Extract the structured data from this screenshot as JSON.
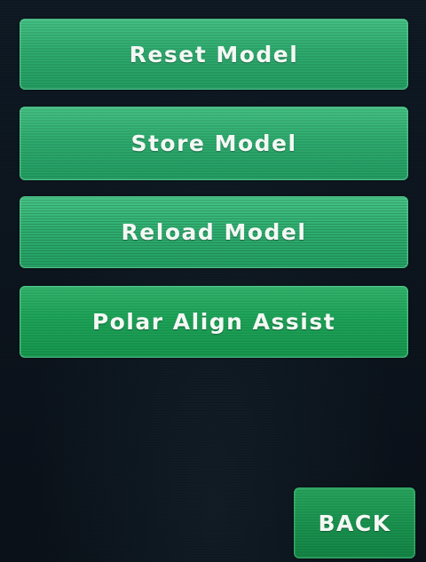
{
  "menu": {
    "buttons": [
      {
        "label": "Reset Model"
      },
      {
        "label": "Store Model"
      },
      {
        "label": "Reload Model"
      },
      {
        "label": "Polar Align Assist"
      }
    ]
  },
  "footer": {
    "back_label": "BACK"
  },
  "colors": {
    "background": "#0e1622",
    "button_green": "#2fae70",
    "button_green_dark": "#1ea75a",
    "button_text": "#f3f8f4"
  }
}
